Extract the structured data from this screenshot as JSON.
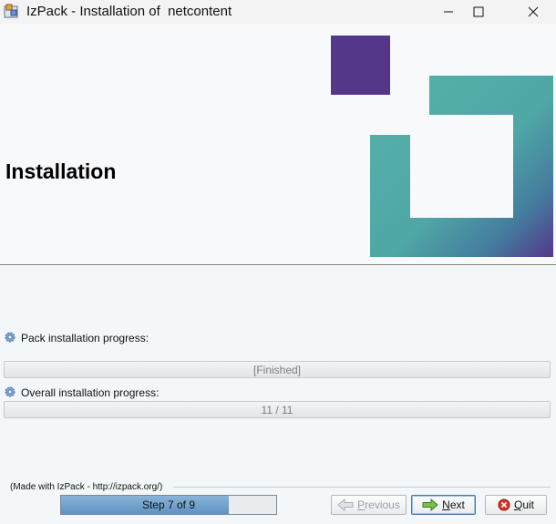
{
  "window": {
    "title": "IzPack - Installation of  netcontent"
  },
  "header": {
    "title": "Installation"
  },
  "content": {
    "pack_label": "Pack installation progress:",
    "pack_status": "[Finished]",
    "overall_label": "Overall installation progress:",
    "overall_status": "11 / 11"
  },
  "footer": {
    "made_with": "(Made with IzPack - http://izpack.org/)",
    "step_text": "Step 7 of 9",
    "step_progress": 0.778
  },
  "buttons": {
    "previous_pre": "",
    "previous_u": "P",
    "previous_post": "revious",
    "next_pre": "",
    "next_u": "N",
    "next_post": "ext",
    "quit_pre": "",
    "quit_u": "Q",
    "quit_post": "uit"
  },
  "colors": {
    "logo_purple": "#55378a",
    "logo_teal": "#56b2aa"
  }
}
